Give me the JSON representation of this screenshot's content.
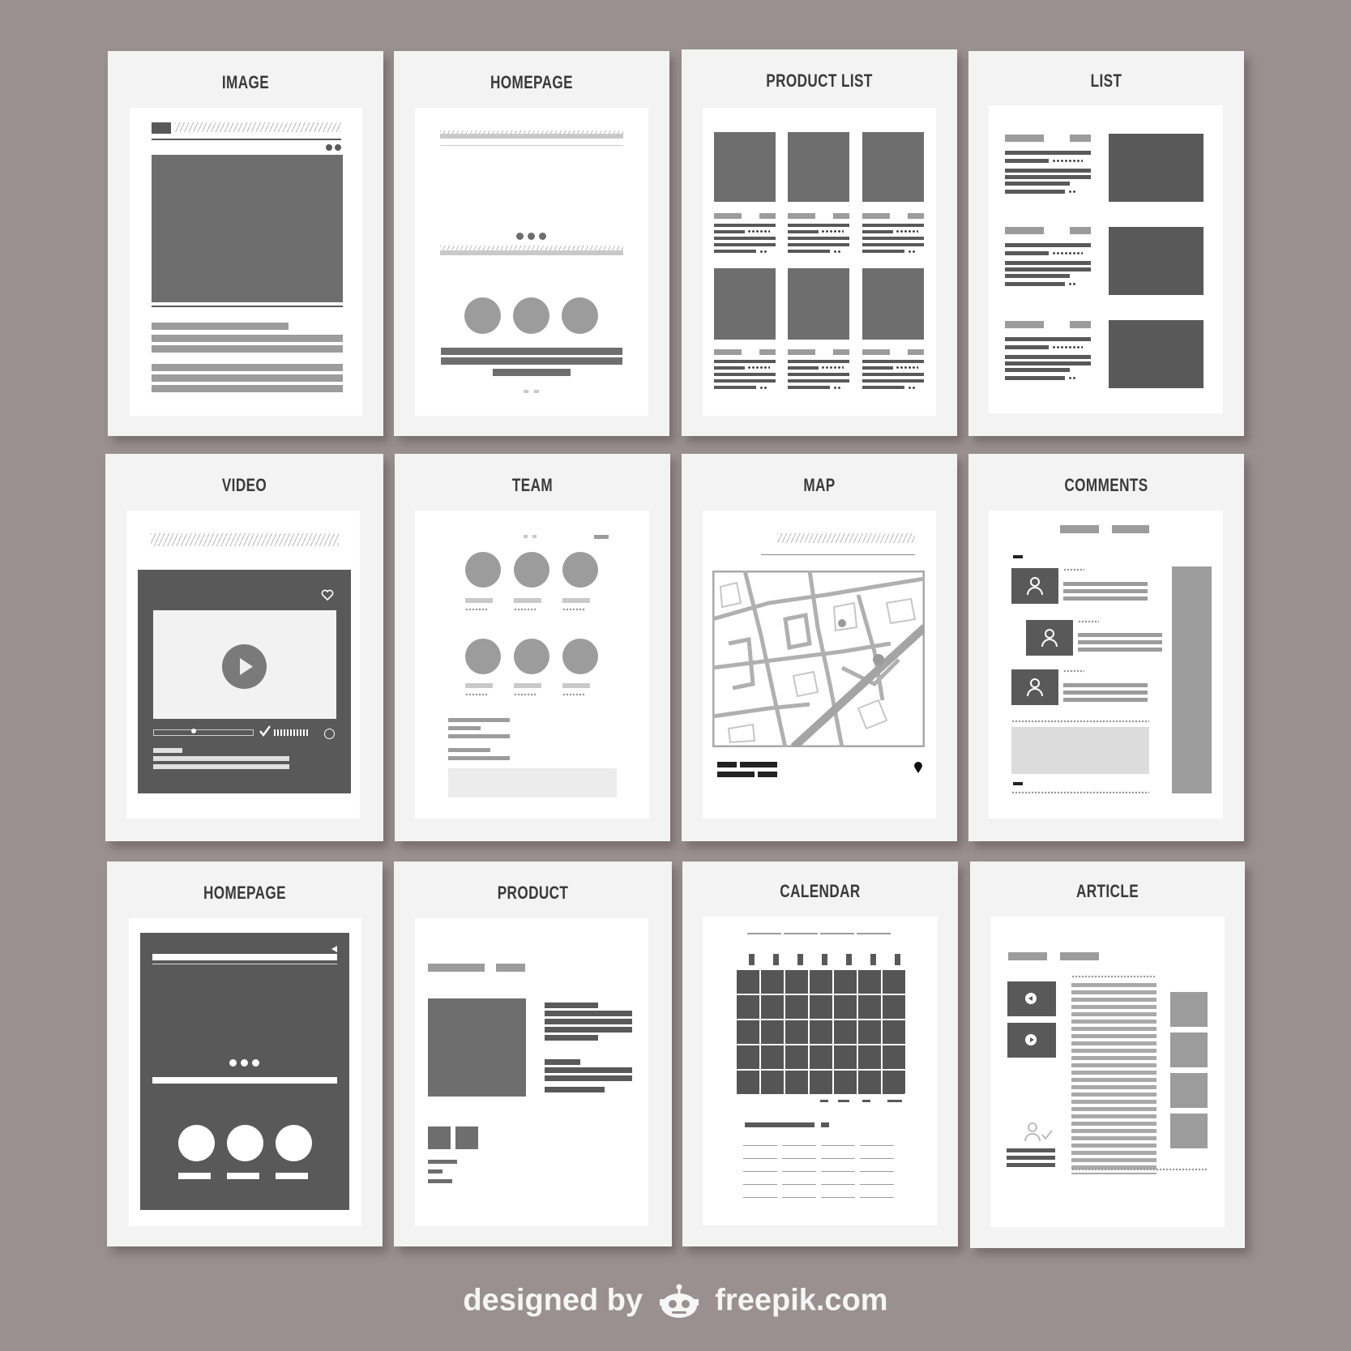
{
  "cards": [
    {
      "title": "IMAGE"
    },
    {
      "title": "HOMEPAGE"
    },
    {
      "title": "PRODUCT LIST"
    },
    {
      "title": "LIST"
    },
    {
      "title": "VIDEO"
    },
    {
      "title": "TEAM"
    },
    {
      "title": "MAP"
    },
    {
      "title": "COMMENTS"
    },
    {
      "title": "HOMEPAGE"
    },
    {
      "title": "PRODUCT"
    },
    {
      "title": "CALENDAR"
    },
    {
      "title": "ARTICLE"
    }
  ],
  "footer": {
    "prefix": "designed by",
    "brand": "freepik.com"
  },
  "icons": {
    "play": "play-icon",
    "heart": "heart-icon",
    "user": "user-icon",
    "map_pin": "map-pin-icon",
    "robot_logo": "freepik-robot-logo"
  }
}
